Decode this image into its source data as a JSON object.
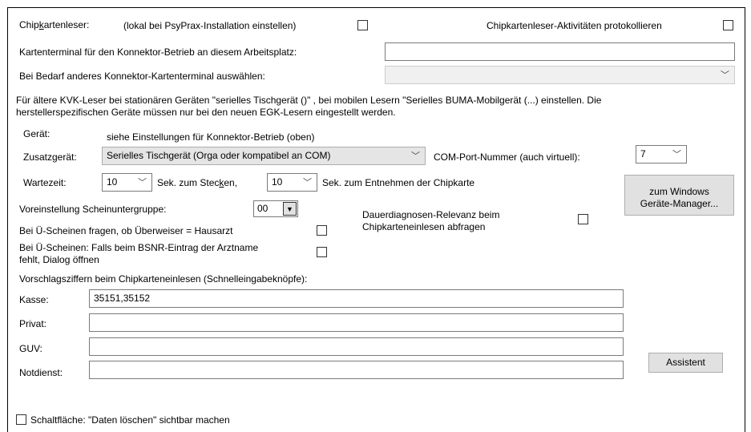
{
  "header": {
    "chipkartenleser_prefix": "Chip",
    "chipkartenleser_underlined": "k",
    "chipkartenleser_suffix": "artenleser:",
    "local_hint": "(lokal bei PsyPrax-Installation einstellen)",
    "protocol_label": "Chipkartenleser-Aktivitäten protokollieren"
  },
  "terminal": {
    "label": "Kartenterminal für den Konnektor-Betrieb an diesem Arbeitsplatz:",
    "value": "",
    "other_label": "Bei Bedarf anderes Konnektor-Kartenterminal auswählen:",
    "other_value": ""
  },
  "info_text_line1": "Für ältere KVK-Leser bei stationären Geräten \"serielles Tischgerät ()\" , bei mobilen Lesern \"Serielles BUMA-Mobilgerät (...) einstellen. Die",
  "info_text_line2": "herstellerspezifischen Geräte müssen nur bei den neuen EGK-Lesern eingestellt werden.",
  "geraet": {
    "label": "Gerät:",
    "value": "siehe Einstellungen für Konnektor-Betrieb (oben)"
  },
  "zusatzgeraet": {
    "label": "Zusatzgerät:",
    "value": "Serielles Tischgerät (Orga oder kompatibel an COM)",
    "com_label": "COM-Port-Nummer (auch virtuell):",
    "com_value": "7"
  },
  "wartezeit": {
    "label": "Wartezeit:",
    "stecken_value": "10",
    "stecken_prefix": "Sek. zum Stec",
    "stecken_underlined": "k",
    "stecken_suffix": "en,",
    "entnehmen_value": "10",
    "entnehmen_label": "Sek. zum Entnehmen der Chipkarte"
  },
  "windows_button": {
    "line1": "zum Windows",
    "line2": "Geräte-Manager..."
  },
  "voreinstellung": {
    "label": "Voreinstellung Scheinuntergruppe:",
    "value": "00"
  },
  "dauerdiagnosen": {
    "line1": "Dauerdiagnosen-Relevanz beim",
    "line2": "Chipkarteneinlesen abfragen"
  },
  "ue_scheinen_fragen": "Bei Ü-Scheinen fragen, ob Überweiser = Hausarzt",
  "ue_scheinen_bsnr_line1": "Bei Ü-Scheinen: Falls beim BSNR-Eintrag der Arztname",
  "ue_scheinen_bsnr_line2": "fehlt, Dialog öffnen",
  "vorschlag_label": "Vorschlagsziffern beim Chipkarteneinlesen (Schnelleingabeknöpfe):",
  "fields": [
    {
      "label": "Kasse:",
      "value": "35151,35152"
    },
    {
      "label": "Privat:",
      "value": ""
    },
    {
      "label": "GUV:",
      "value": ""
    },
    {
      "label": "Notdienst:",
      "value": ""
    }
  ],
  "assistent_label": "Assistent",
  "daten_loeschen_label": "Schaltfläche: \"Daten löschen\" sichtbar machen",
  "icons": {
    "dropdown": "chevron-down-icon",
    "dropdown_small": "triangle-down-icon"
  }
}
